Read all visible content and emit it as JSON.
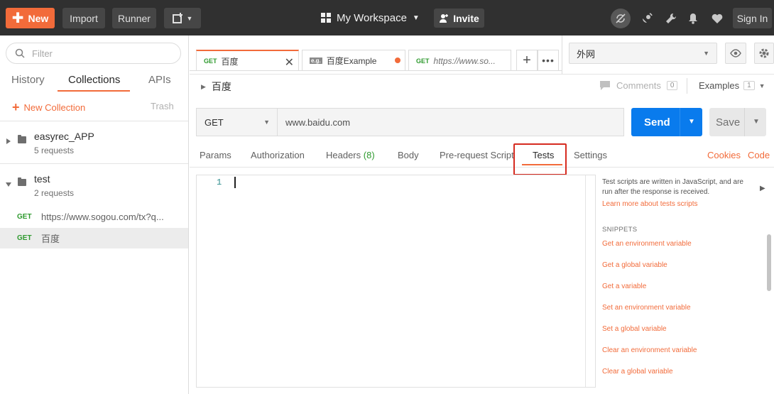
{
  "topbar": {
    "new_label": "New",
    "import_label": "Import",
    "runner_label": "Runner",
    "workspace_label": "My Workspace",
    "invite_label": "Invite",
    "signin_label": "Sign In"
  },
  "sidebar": {
    "filter_placeholder": "Filter",
    "tabs": [
      "History",
      "Collections",
      "APIs"
    ],
    "active_tab": "Collections",
    "new_collection_label": "New Collection",
    "trash_label": "Trash",
    "collections": [
      {
        "name": "easyrec_APP",
        "count": "5 requests"
      },
      {
        "name": "test",
        "count": "2 requests"
      }
    ],
    "requests": [
      {
        "method": "GET",
        "url": "https://www.sogou.com/tx?q..."
      },
      {
        "method": "GET",
        "url": "百度"
      }
    ]
  },
  "tabs": [
    {
      "method": "GET",
      "title": "百度"
    },
    {
      "method": "e.g.",
      "title": "百度Example"
    },
    {
      "method": "GET",
      "title": "https://www.so..."
    }
  ],
  "environment": {
    "selected": "外网"
  },
  "request": {
    "title": "百度",
    "comments_label": "Comments",
    "comments_count": "0",
    "examples_label": "Examples",
    "examples_count": "1",
    "method": "GET",
    "url": "www.baidu.com",
    "send_label": "Send",
    "save_label": "Save"
  },
  "request_tabs": {
    "params": "Params",
    "authorization": "Authorization",
    "headers": "Headers",
    "headers_count": "(8)",
    "body": "Body",
    "prerequest": "Pre-request Script",
    "tests": "Tests",
    "settings": "Settings",
    "cookies": "Cookies",
    "code": "Code",
    "active": "Tests"
  },
  "editor": {
    "line_number": "1"
  },
  "snippets_panel": {
    "description": "Test scripts are written in JavaScript, and are run after the response is received.",
    "learn_more": "Learn more about tests scripts",
    "heading": "SNIPPETS",
    "items": [
      "Get an environment variable",
      "Get a global variable",
      "Get a variable",
      "Set an environment variable",
      "Set a global variable",
      "Clear an environment variable",
      "Clear a global variable"
    ]
  },
  "colors": {
    "accent": "#f26b3a",
    "send": "#097bed",
    "highlight": "#d62b20",
    "get_method": "#2f9a2f"
  }
}
